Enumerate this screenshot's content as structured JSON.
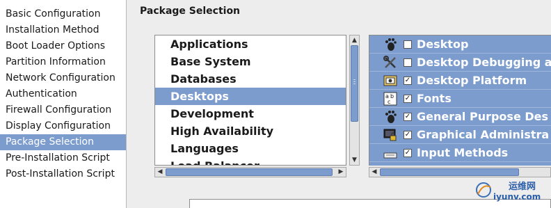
{
  "sidebar": {
    "items": [
      {
        "label": "Basic Configuration",
        "selected": false
      },
      {
        "label": "Installation Method",
        "selected": false
      },
      {
        "label": "Boot Loader Options",
        "selected": false
      },
      {
        "label": "Partition Information",
        "selected": false
      },
      {
        "label": "Network Configuration",
        "selected": false
      },
      {
        "label": "Authentication",
        "selected": false
      },
      {
        "label": "Firewall Configuration",
        "selected": false
      },
      {
        "label": "Display Configuration",
        "selected": false
      },
      {
        "label": "Package Selection",
        "selected": true
      },
      {
        "label": "Pre-Installation Script",
        "selected": false
      },
      {
        "label": "Post-Installation Script",
        "selected": false
      }
    ]
  },
  "main": {
    "title": "Package Selection",
    "groups": [
      {
        "label": "Applications",
        "selected": false
      },
      {
        "label": "Base System",
        "selected": false
      },
      {
        "label": "Databases",
        "selected": false
      },
      {
        "label": "Desktops",
        "selected": true
      },
      {
        "label": "Development",
        "selected": false
      },
      {
        "label": "High Availability",
        "selected": false
      },
      {
        "label": "Languages",
        "selected": false
      },
      {
        "label": "Load Balancer",
        "selected": false
      }
    ],
    "packages": [
      {
        "label": "Desktop",
        "checked": false,
        "icon": "gnome-foot-icon"
      },
      {
        "label": "Desktop Debugging a",
        "checked": false,
        "icon": "tools-icon"
      },
      {
        "label": "Desktop Platform",
        "checked": true,
        "icon": "platform-icon"
      },
      {
        "label": "Fonts",
        "checked": true,
        "icon": "fonts-icon"
      },
      {
        "label": "General Purpose Des",
        "checked": true,
        "icon": "gnome-foot-icon"
      },
      {
        "label": "Graphical Administra",
        "checked": true,
        "icon": "monitor-lock-icon"
      },
      {
        "label": "Input Methods",
        "checked": true,
        "icon": "keyboard-icon"
      }
    ]
  },
  "watermark": {
    "text_cn": "运维网",
    "text_url": "iyunv.com"
  },
  "colors": {
    "selection": "#7b9ccd",
    "sidebar_bg": "#ffffff",
    "window_bg": "#ededed"
  }
}
